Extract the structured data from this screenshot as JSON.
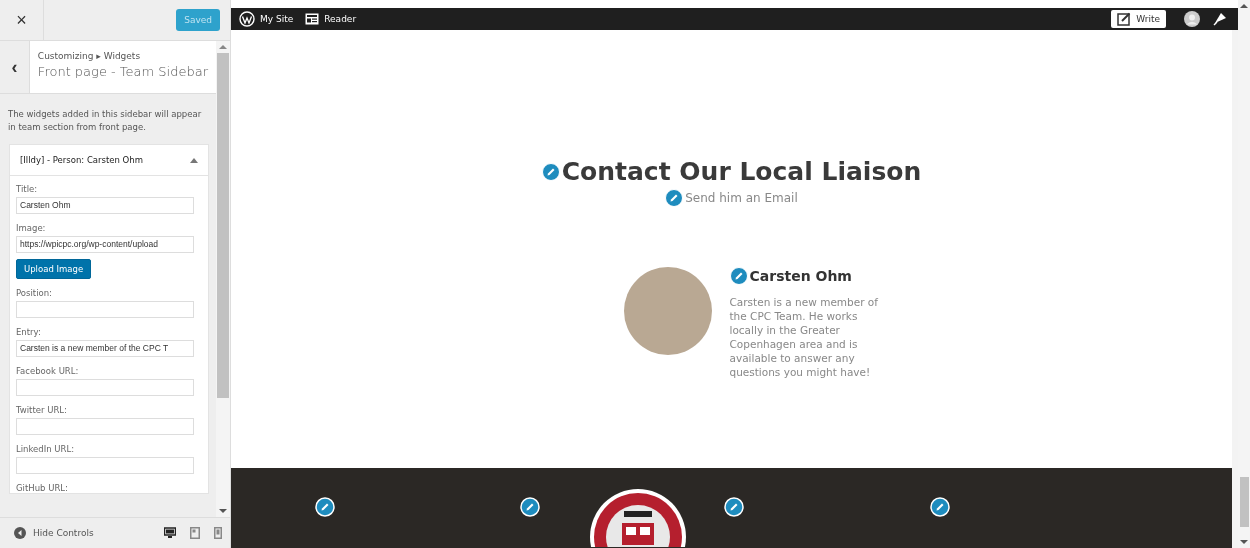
{
  "customizer": {
    "close": "×",
    "save_button": "Saved",
    "back": "‹",
    "breadcrumb": "Customizing ▸ Widgets",
    "section_title": "Front page - Team Sidebar",
    "description": "The widgets added in this sidebar will appear in team section from front page.",
    "widget": {
      "title": "[Illdy] - Person: Carsten Ohm",
      "expanded": true,
      "fields": [
        {
          "kind": "input",
          "label": "Title:",
          "value": "Carsten Ohm"
        },
        {
          "kind": "input",
          "label": "Image:",
          "value": "https://wpicpc.org/wp-content/upload",
          "button": "Upload Image"
        },
        {
          "kind": "input",
          "label": "Position:"
        },
        {
          "kind": "input",
          "label": "Entry:",
          "value": "Carsten is a new member of the CPC T"
        },
        {
          "kind": "input",
          "label": "Facebook URL:"
        },
        {
          "kind": "input",
          "label": "Twitter URL:"
        },
        {
          "kind": "input",
          "label": "LinkedIn URL:"
        },
        {
          "kind": "label",
          "label": "GitHub URL:"
        }
      ]
    },
    "footer": {
      "hide_controls": "Hide Controls",
      "devices": [
        {
          "kind": "desktop",
          "selected": true
        },
        {
          "kind": "tablet",
          "selected": false
        },
        {
          "kind": "mobile",
          "selected": false
        }
      ]
    }
  },
  "admin_bar": {
    "my_site": "My Site",
    "reader": "Reader",
    "write": "Write"
  },
  "preview": {
    "heading": "Contact Our Local Liaison",
    "subheading": "Send him an Email",
    "person": {
      "name": "Carsten Ohm",
      "bio": "Carsten is a new member of the CPC Team. He works locally in the Greater Copenhagen area and is available to answer any questions you might have!"
    }
  }
}
